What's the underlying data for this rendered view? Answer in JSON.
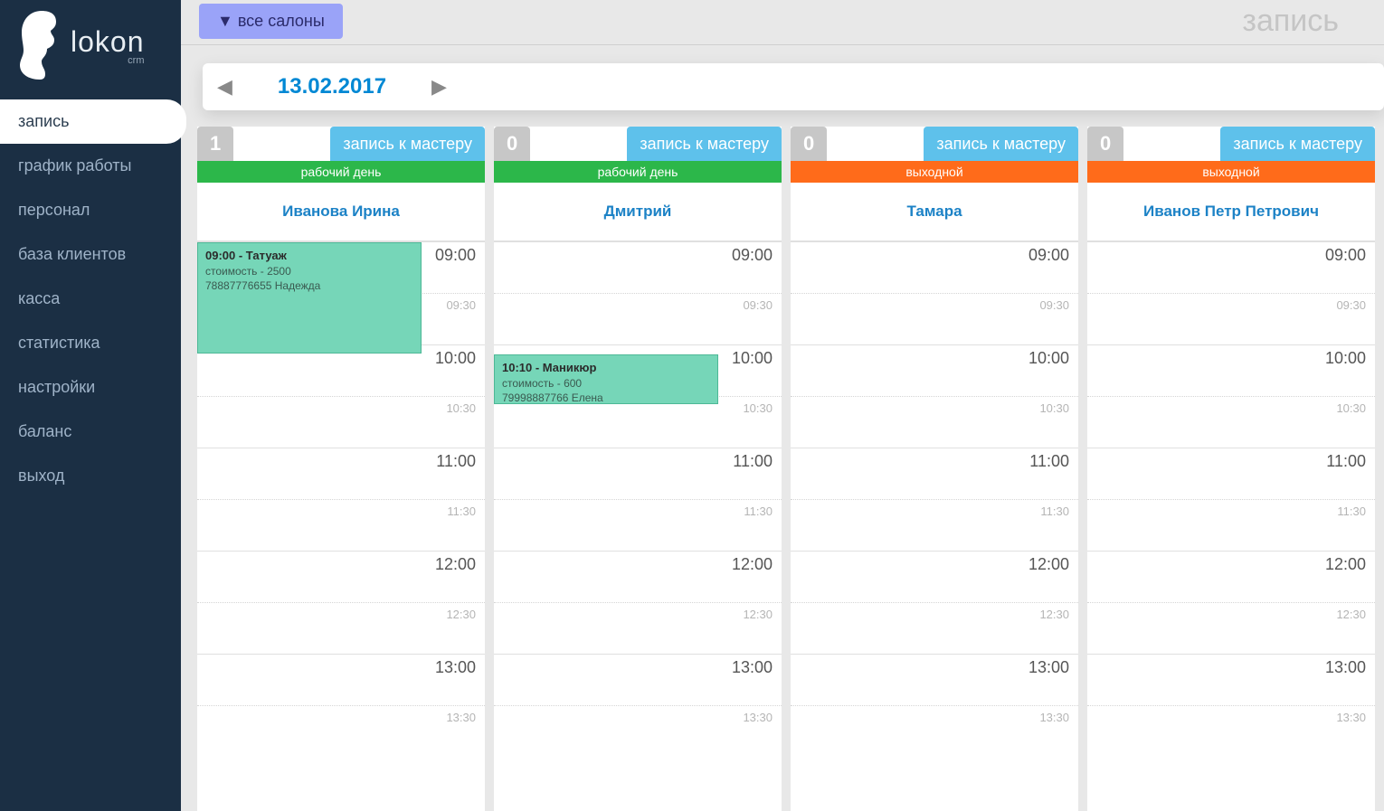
{
  "brand": {
    "name": "lokon",
    "sub": "crm"
  },
  "nav": [
    {
      "label": "запись",
      "active": true
    },
    {
      "label": "график работы",
      "active": false
    },
    {
      "label": "персонал",
      "active": false
    },
    {
      "label": "база клиентов",
      "active": false
    },
    {
      "label": "касса",
      "active": false
    },
    {
      "label": "статистика",
      "active": false
    },
    {
      "label": "настройки",
      "active": false
    },
    {
      "label": "баланс",
      "active": false
    },
    {
      "label": "выход",
      "active": false
    }
  ],
  "header": {
    "salonDropdown": "▼ все салоны",
    "pageTitle": "запись"
  },
  "datePicker": {
    "date": "13.02.2017"
  },
  "timeSlots": [
    "09:00",
    "09:30",
    "10:00",
    "10:30",
    "11:00",
    "11:30",
    "12:00",
    "12:30",
    "13:00",
    "13:30"
  ],
  "assignButtonLabel": "запись к мастеру",
  "statusLabels": {
    "work": "рабочий день",
    "off": "выходной"
  },
  "masters": [
    {
      "name": "Иванова Ирина",
      "count": "1",
      "status": "work",
      "appointments": [
        {
          "slotIndex": 0,
          "durationSlots": 2.2,
          "widthPct": 78,
          "title": "09:00 - Татуаж",
          "price": "стоимость - 2500",
          "client": "78887776655 Надежда"
        }
      ]
    },
    {
      "name": "Дмитрий",
      "count": "0",
      "status": "work",
      "appointments": [
        {
          "slotIndex": 2.18,
          "durationSlots": 1.0,
          "widthPct": 78,
          "title": "10:10 - Маникюр",
          "price": "стоимость - 600",
          "client": "79998887766 Елена"
        }
      ]
    },
    {
      "name": "Тамара",
      "count": "0",
      "status": "off",
      "appointments": []
    },
    {
      "name": "Иванов Петр Петрович",
      "count": "0",
      "status": "off",
      "appointments": []
    }
  ]
}
